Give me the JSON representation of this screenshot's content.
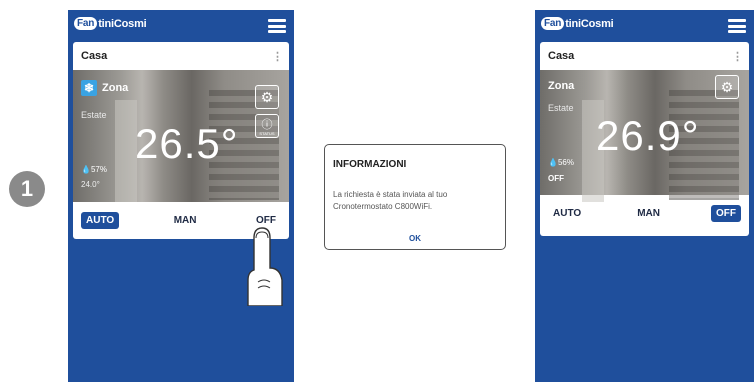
{
  "step_number": "1",
  "colors": {
    "brand_blue": "#1f4f9c",
    "snow_icon": "#3aa3e3"
  },
  "phone_left": {
    "brand": {
      "logo_part": "Fan",
      "rest": "tiniCosmi"
    },
    "card_title": "Casa",
    "zone_name": "Zona",
    "season": "Estate",
    "temperature": "26.5°",
    "humidity": "57%",
    "setpoint": "24.0°",
    "info_sub": "STATUS",
    "modes": [
      {
        "label": "AUTO",
        "active": true
      },
      {
        "label": "MAN",
        "active": false
      },
      {
        "label": "OFF",
        "active": false
      }
    ]
  },
  "dialog": {
    "title": "INFORMAZIONI",
    "message": "La richiesta è stata inviata al tuo Cronotermostato C800WiFi.",
    "ok_label": "OK"
  },
  "phone_right": {
    "brand": {
      "logo_part": "Fan",
      "rest": "tiniCosmi"
    },
    "card_title": "Casa",
    "zone_name": "Zona",
    "season": "Estate",
    "temperature": "26.9°",
    "humidity": "56%",
    "status": "OFF",
    "modes": [
      {
        "label": "AUTO",
        "active": false
      },
      {
        "label": "MAN",
        "active": false
      },
      {
        "label": "OFF",
        "active": true
      }
    ]
  }
}
